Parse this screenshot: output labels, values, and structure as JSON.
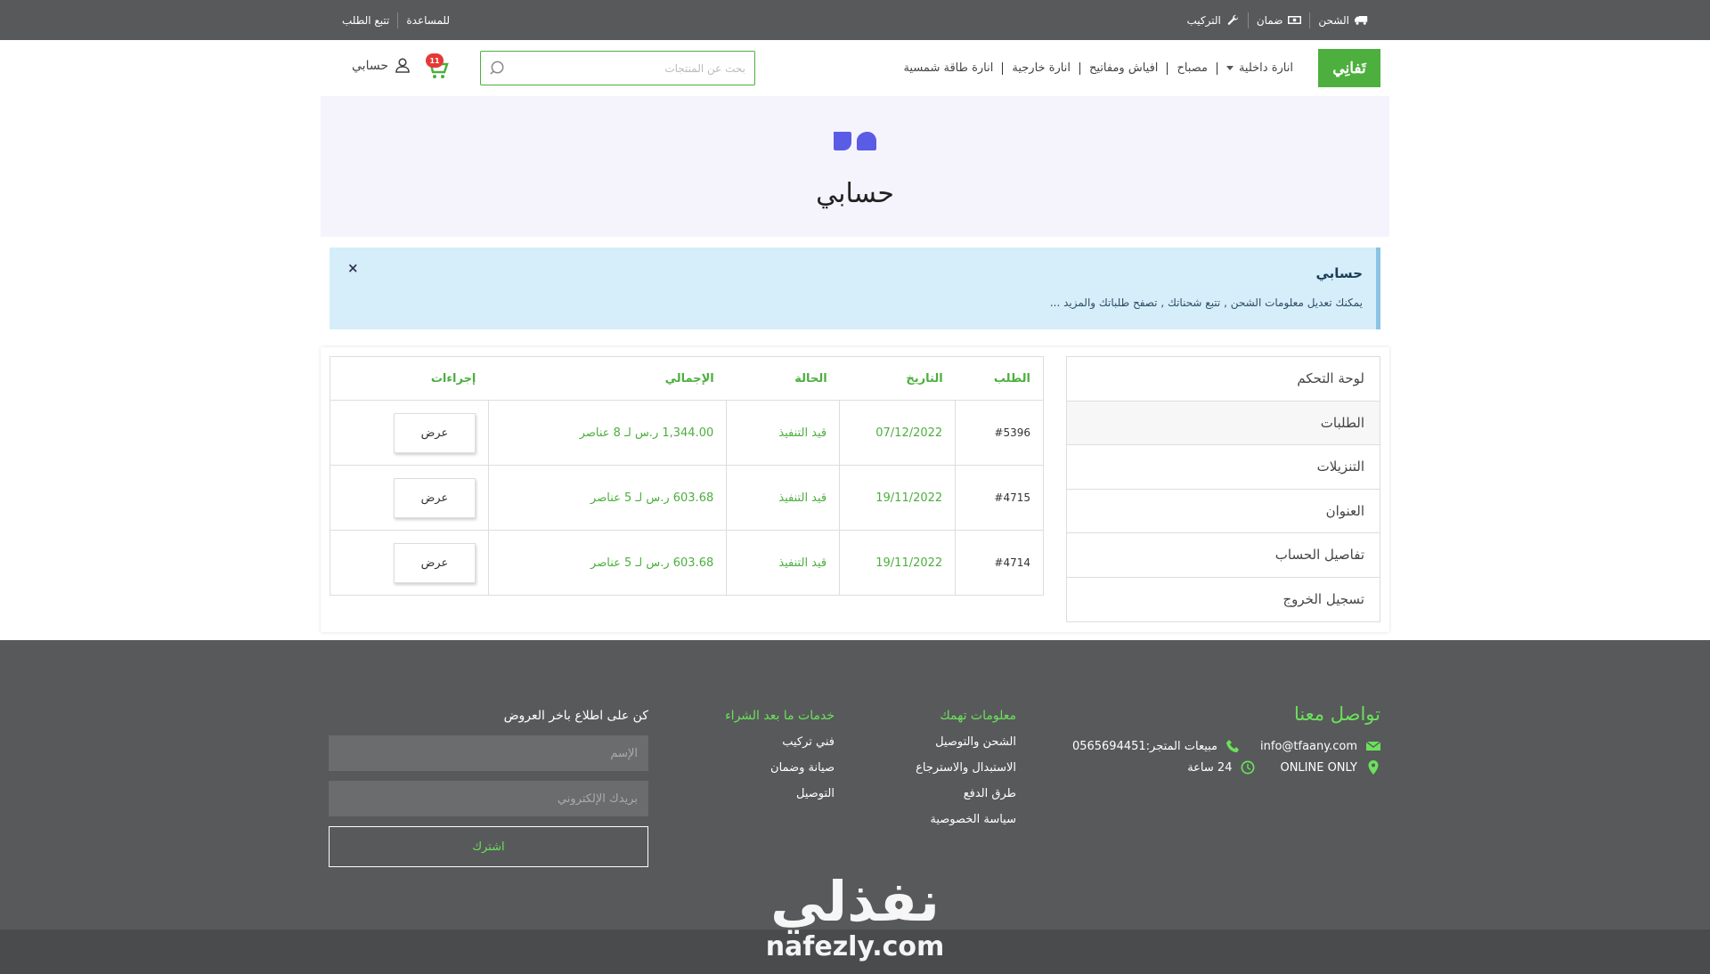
{
  "topbar": {
    "right": [
      {
        "label": "الشحن",
        "icon": "truck-icon"
      },
      {
        "label": "ضمان",
        "icon": "money-icon"
      },
      {
        "label": "التركيب",
        "icon": "wrench-icon"
      }
    ],
    "left": [
      {
        "label": "للمساعدة"
      },
      {
        "label": "تتبع الطلب"
      }
    ]
  },
  "header": {
    "logo_text": "تَفانِي",
    "nav": [
      "انارة داخلية",
      "مصباح",
      "افياش ومفاتيح",
      "انارة خارجية",
      "انارة طاقة شمسية"
    ],
    "search_placeholder": "بحث عن المنتجات",
    "cart_count": "11",
    "account_label": "حسابي"
  },
  "hero": {
    "title": "حسابي"
  },
  "alert": {
    "title": "حسابي",
    "text": "يمكنك تعديل معلومات الشحن , تتبع شحناتك , تصفح طلباتك والمزيد ...",
    "close": "×"
  },
  "sidebar": {
    "items": [
      "لوحة التحكم",
      "الطلبات",
      "التنزيلات",
      "العنوان",
      "تفاصيل الحساب",
      "تسجيل الخروج"
    ]
  },
  "orders": {
    "headers": [
      "الطلب",
      "التاريخ",
      "الحالة",
      "الإجمالي",
      "إجراءات"
    ],
    "rows": [
      {
        "order": "#5396",
        "date": "07/12/2022",
        "status": "قيد التنفيذ",
        "total": "1,344.00 ر.س لـ 8 عناصر",
        "action": "عرض"
      },
      {
        "order": "#4715",
        "date": "19/11/2022",
        "status": "قيد التنفيذ",
        "total": "603.68 ر.س لـ 5 عناصر",
        "action": "عرض"
      },
      {
        "order": "#4714",
        "date": "19/11/2022",
        "status": "قيد التنفيذ",
        "total": "603.68 ر.س لـ 5 عناصر",
        "action": "عرض"
      }
    ]
  },
  "footer": {
    "contact": {
      "title": "تواصل معنا",
      "email": "info@tfaany.com",
      "phone": "مبيعات المتجر:0565694451",
      "location": "ONLINE ONLY",
      "hours": "24 ساعة"
    },
    "info": {
      "title": "معلومات تهمك",
      "links": [
        "الشحن والتوصيل",
        "الاستبدال والاسترجاع",
        "طرق الدفع",
        "سياسة الخصوصية"
      ]
    },
    "services": {
      "title": "خدمات ما بعد الشراء",
      "links": [
        "فني تركيب",
        "صيانة وضمان",
        "التوصيل"
      ]
    },
    "newsletter": {
      "title": "كن على اطلاع باخر العروض",
      "name_placeholder": "الإسم",
      "email_placeholder": "بريدك الإلكتروني",
      "button": "اشترك"
    }
  },
  "watermark": {
    "ar": "نفذلي",
    "en": "nafezly.com"
  },
  "colors": {
    "accent": "#4caf3e",
    "footer_accent": "#6ae25a",
    "dark": "#58595b",
    "hero_bg": "#f5f4fd",
    "alert_bg": "#d5eefa"
  }
}
